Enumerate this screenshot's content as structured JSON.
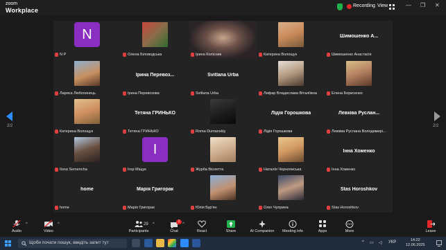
{
  "app": {
    "logo_line1": "zoom",
    "logo_line2": "Workplace"
  },
  "topbar": {
    "recording_label": "Recording",
    "view_label": "View",
    "view_icon": "grid-icon"
  },
  "nav": {
    "left_page": "2/2",
    "right_page": "2/2"
  },
  "tiles": [
    {
      "id": "t0",
      "kind": "initial",
      "initial": "N",
      "name": "N P"
    },
    {
      "id": "t1",
      "kind": "photo",
      "name": "Олена Біловодська"
    },
    {
      "id": "t2",
      "kind": "video",
      "name": "Ірина Колісник"
    },
    {
      "id": "t3",
      "kind": "photo",
      "name": "Катерина Волощук"
    },
    {
      "id": "t4",
      "kind": "text",
      "display": "Шимошенко А...",
      "name": "Шимошенко Анастасія"
    },
    {
      "id": "t5",
      "kind": "photo",
      "name": "Лариса Любохинець"
    },
    {
      "id": "t6",
      "kind": "text",
      "display": "Ірина Перевоз...",
      "name": "Ірина Перевозова"
    },
    {
      "id": "t7",
      "kind": "text",
      "display": "Svitlana Urba",
      "name": "Svitlana Urba"
    },
    {
      "id": "t8",
      "kind": "photo",
      "name": "Лифар Владислава Віталіївна"
    },
    {
      "id": "t9",
      "kind": "photo",
      "name": "Елена Борисенко"
    },
    {
      "id": "t10",
      "kind": "photo",
      "name": "Катерина Волощук"
    },
    {
      "id": "t11",
      "kind": "text",
      "display": "Тетяна ГРИНЬКО",
      "name": "Тетяна ГРИНЬКО"
    },
    {
      "id": "t12",
      "kind": "photo",
      "name": "Roma Dumanskiy"
    },
    {
      "id": "t13",
      "kind": "text",
      "display": "Лідія Горошкова",
      "name": "Лідія Горошкова"
    },
    {
      "id": "t14",
      "kind": "text",
      "display": "Левківа Руслан...",
      "name": "Левківа Руслана Володимирі..."
    },
    {
      "id": "t15",
      "kind": "photo",
      "name": "Ilona Semencha"
    },
    {
      "id": "t16",
      "kind": "initial",
      "initial": "І",
      "name": "Ігор Міщук"
    },
    {
      "id": "t17",
      "kind": "photo",
      "name": "Журба Віолетта"
    },
    {
      "id": "t18",
      "kind": "photo",
      "name": "Наталія Чорнописька"
    },
    {
      "id": "t19",
      "kind": "text",
      "display": "Інна Хоменко",
      "name": "Інна Хоменко"
    },
    {
      "id": "t20",
      "kind": "text",
      "display": "home",
      "name": "home"
    },
    {
      "id": "t21",
      "kind": "text",
      "display": "Марія Григорак",
      "name": "Марія Григорак"
    },
    {
      "id": "t22",
      "kind": "photo",
      "name": "Юлія Бур'ян"
    },
    {
      "id": "t23",
      "kind": "photo",
      "name": "Олег Чуприна"
    },
    {
      "id": "t24",
      "kind": "text",
      "display": "Stas Horoshkov",
      "name": "Stas Horoshkov"
    }
  ],
  "toolbar": {
    "audio": "Audio",
    "video": "Video",
    "participants": "Participants",
    "participants_count": "29",
    "chat": "Chat",
    "chat_badge": "1",
    "react": "React",
    "share": "Share",
    "ai_companion": "AI Companion",
    "meeting_info": "Meeting info",
    "apps": "Apps",
    "more": "More",
    "leave": "Leave"
  },
  "taskbar": {
    "search_placeholder": "Щоби почати пошук, введіть запит тут",
    "language": "УКР",
    "time": "14:22",
    "date": "12.06.2025"
  },
  "colors": {
    "accent": "#2d8cff",
    "leave": "#e02828",
    "initial_bg": "#8a2ec1",
    "share": "#22b14c"
  }
}
